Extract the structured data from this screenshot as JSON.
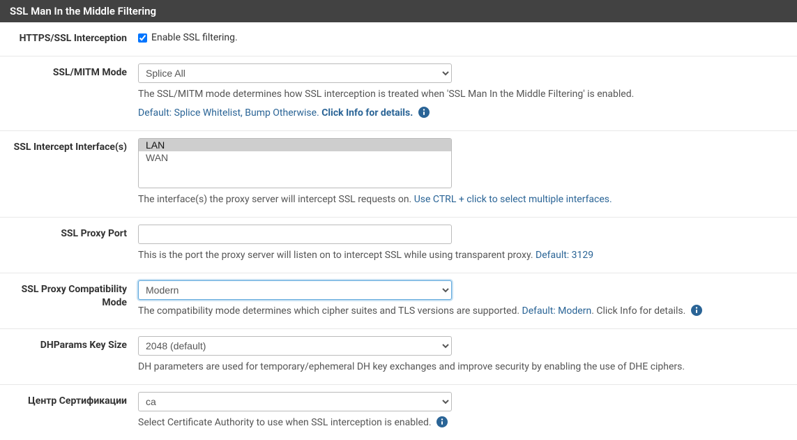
{
  "panel": {
    "title": "SSL Man In the Middle Filtering"
  },
  "fields": {
    "interception": {
      "label": "HTTPS/SSL Interception",
      "checkbox_label": "Enable SSL filtering."
    },
    "ssl_mode": {
      "label": "SSL/MITM Mode",
      "value": "Splice All",
      "help1": "The SSL/MITM mode determines how SSL interception is treated when 'SSL Man In the Middle Filtering' is enabled.",
      "help2a": "Default: Splice Whitelist, Bump Otherwise. ",
      "help2b": "Click Info for details."
    },
    "intercept_iface": {
      "label": "SSL Intercept Interface(s)",
      "options": [
        "LAN",
        "WAN"
      ],
      "help_a": "The interface(s) the proxy server will intercept SSL requests on. ",
      "help_b": "Use CTRL + click to select multiple interfaces."
    },
    "proxy_port": {
      "label": "SSL Proxy Port",
      "value": "",
      "help_a": "This is the port the proxy server will listen on to intercept SSL while using transparent proxy. ",
      "help_b": "Default: 3129"
    },
    "compat": {
      "label": "SSL Proxy Compatibility Mode",
      "value": "Modern",
      "help_a": "The compatibility mode determines which cipher suites and TLS versions are supported. ",
      "help_b": "Default: Modern",
      "help_c": ". Click Info for details."
    },
    "dh": {
      "label": "DHParams Key Size",
      "value": "2048 (default)",
      "help": "DH parameters are used for temporary/ephemeral DH key exchanges and improve security by enabling the use of DHE ciphers."
    },
    "ca": {
      "label": "Центр Сертификации",
      "value": "ca",
      "help": "Select Certificate Authority to use when SSL interception is enabled."
    }
  }
}
